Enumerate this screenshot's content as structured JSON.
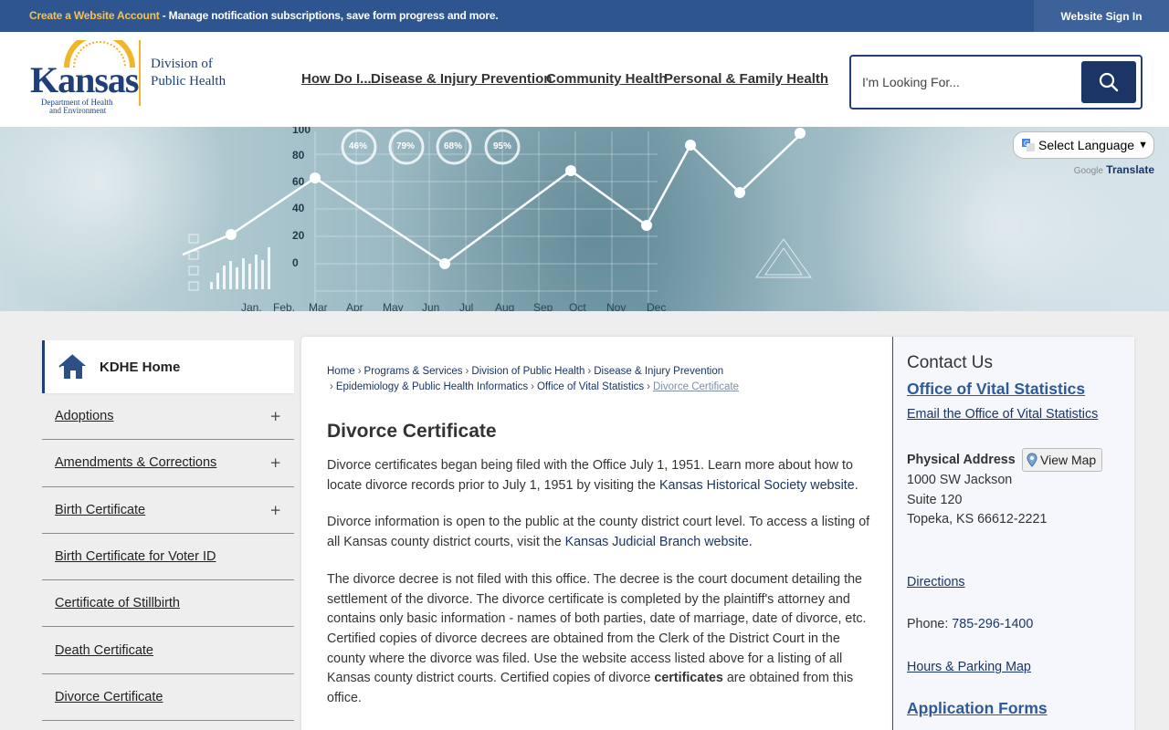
{
  "topbar": {
    "create_account": "Create a Website Account",
    "message": " - Manage notification subscriptions, save form progress and more.",
    "sign_in": "Website Sign In"
  },
  "logo": {
    "name": "Kansas",
    "dept_line1": "Department of Health",
    "dept_line2": "and Environment",
    "division_line1": "Division of",
    "division_line2": "Public Health"
  },
  "nav": {
    "items": [
      "How Do I...",
      "Disease & Injury Prevention",
      "Community Health",
      "Personal & Family Health"
    ]
  },
  "search": {
    "placeholder": "I'm Looking For...",
    "icon": "search-icon"
  },
  "banner": {
    "y_ticks": [
      "100",
      "80",
      "60",
      "40",
      "20",
      "0"
    ],
    "months": [
      "Jan.",
      "Feb.",
      "Mar",
      "Apr",
      "May",
      "Jun",
      "Jul",
      "Aug",
      "Sep",
      "Oct",
      "Nov",
      "Dec"
    ],
    "percents": [
      "46%",
      "79%",
      "68%",
      "95%"
    ]
  },
  "translate": {
    "select_label": "Select Language",
    "powered": "Google",
    "translate_link": "Translate"
  },
  "sidebar": {
    "home": "KDHE Home",
    "items": [
      {
        "label": "Adoptions",
        "expand": "+"
      },
      {
        "label": "Amendments & Corrections",
        "expand": "+"
      },
      {
        "label": "Birth Certificate",
        "expand": "+"
      },
      {
        "label": "Birth Certificate for Voter ID",
        "expand": ""
      },
      {
        "label": "Certificate of Stillbirth",
        "expand": ""
      },
      {
        "label": "Death Certificate",
        "expand": ""
      },
      {
        "label": "Divorce Certificate",
        "expand": ""
      }
    ]
  },
  "breadcrumb": {
    "items": [
      "Home",
      "Programs & Services",
      "Division of Public Health",
      "Disease & Injury Prevention",
      "Epidemiology & Public Health Informatics",
      "Office of Vital Statistics"
    ],
    "current": "Divorce Certificate",
    "sep": "›"
  },
  "main": {
    "title": "Divorce Certificate",
    "p1_a": "Divorce certificates began being filed with the Office July 1, 1951. Learn more about how to locate divorce records prior to July 1, 1951 by visiting the ",
    "p1_link": "Kansas Historical Society website",
    "p1_b": ".",
    "p2_a": "Divorce information is open to the public at the county district court level. To access a listing of all Kansas county district courts, visit the ",
    "p2_link": "Kansas Judicial Branch website",
    "p2_b": ".",
    "p3_a": "The divorce decree is not filed with this office. The decree is the court document detailing the settlement of the divorce. The divorce certificate is completed by the plaintiff's attorney and contains only basic information - names of both parties, date of marriage, date of divorce, etc. Certified copies of divorce decrees are obtained from the Clerk of the District Court in the county where the divorce was filed. Use the website access listed above for a listing of all Kansas county district courts. Certified copies of divorce ",
    "p3_bold": "certificates",
    "p3_b": " are obtained from this office."
  },
  "contact": {
    "heading": "Contact Us",
    "office": "Office of Vital Statistics",
    "email": "Email the Office of Vital Statistics",
    "address_label": "Physical Address",
    "view_map": "View Map",
    "address": [
      "1000 SW Jackson",
      "Suite 120",
      "Topeka, KS 66612-2221"
    ],
    "directions": "Directions",
    "phone_label": "Phone: ",
    "phone": "785-296-1400",
    "hours": "Hours & Parking Map",
    "forms": "Application Forms"
  }
}
